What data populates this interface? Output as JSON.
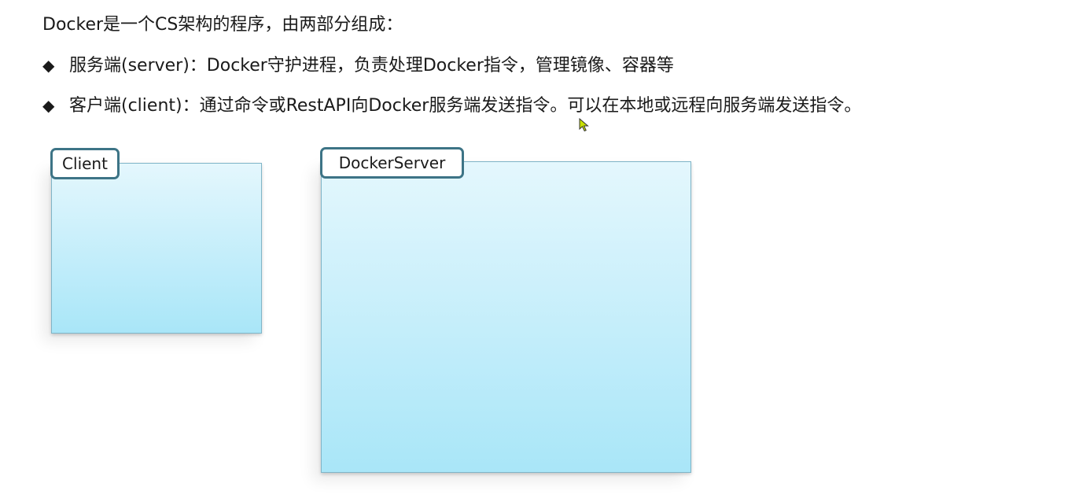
{
  "text": {
    "intro": "Docker是一个CS架构的程序，由两部分组成：",
    "bullets": [
      {
        "marker": "◆",
        "text": "服务端(server)：Docker守护进程，负责处理Docker指令，管理镜像、容器等"
      },
      {
        "marker": "◆",
        "text": "客户端(client)：通过命令或RestAPI向Docker服务端发送指令。可以在本地或远程向服务端发送指令。"
      }
    ]
  },
  "diagram": {
    "client": {
      "label": "Client"
    },
    "server": {
      "label": "DockerServer"
    }
  },
  "colors": {
    "tag_border": "#3d7486",
    "box_top": "#e4f7fd",
    "box_bottom": "#a9e6f8",
    "cursor": "#c8e000"
  },
  "icons": {
    "bullet": "diamond-bullet-icon",
    "cursor": "mouse-pointer-icon"
  }
}
